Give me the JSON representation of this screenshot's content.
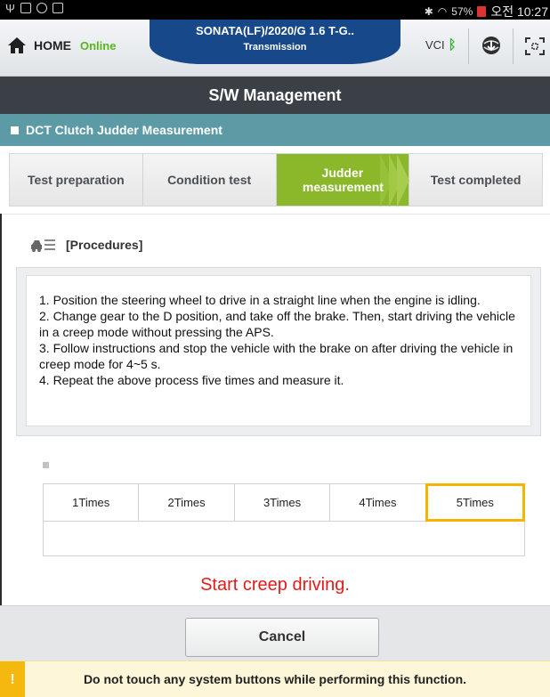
{
  "statusbar": {
    "battery": "57%",
    "time": "오전 10:27",
    "icons": [
      "usb-icon",
      "image-icon",
      "voicemail-icon",
      "sim-icon",
      "bluetooth-icon",
      "wifi-icon",
      "battery-icon"
    ]
  },
  "header": {
    "home_label": "HOME",
    "status": "Online",
    "vehicle_model": "SONATA(LF)/2020/G 1.6 T-G..",
    "vehicle_system": "Transmission",
    "vci_label": "VCI",
    "colors": {
      "online": "#59b51c",
      "vehicle_banner": "#16488a"
    }
  },
  "title": "S/W Management",
  "section_title": "DCT Clutch Judder Measurement",
  "steps": [
    {
      "label": "Test preparation",
      "active": false
    },
    {
      "label": "Condition test",
      "active": false
    },
    {
      "label": "Judder measurement",
      "active": true
    },
    {
      "label": "Test completed",
      "active": false
    }
  ],
  "procedures": {
    "heading": "[Procedures]",
    "lines": [
      "1. Position the steering wheel to drive in a straight line when the engine is idling.",
      "2. Change gear to the D position, and take off the brake. Then, start driving the vehicle in a creep mode without pressing the APS.",
      "3. Follow instructions and stop the vehicle with the brake on after driving the vehicle in creep mode for 4~5 s.",
      "4. Repeat the above process five times and measure it."
    ]
  },
  "times": {
    "columns": [
      "1Times",
      "2Times",
      "3Times",
      "4Times",
      "5Times"
    ],
    "selected_index": 4,
    "highlight_color": "#f5b400"
  },
  "message": "Start creep driving.",
  "cancel_label": "Cancel",
  "warning": "Do not touch any system buttons while performing this function."
}
